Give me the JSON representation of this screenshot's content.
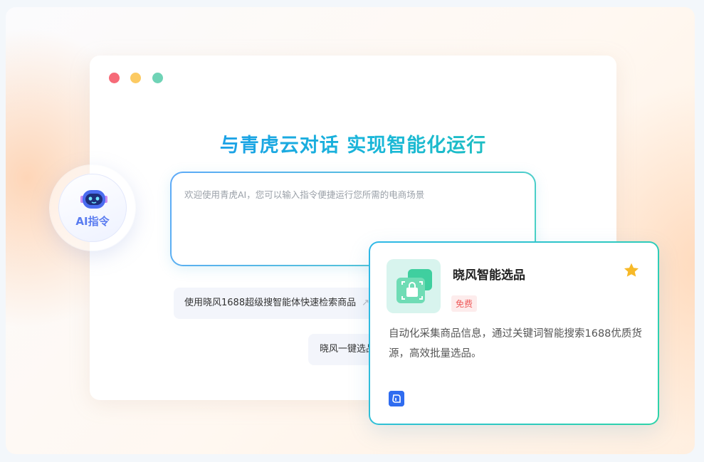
{
  "headline": "与青虎云对话 实现智能化运行",
  "prompt": {
    "placeholder": "欢迎使用青虎AI，您可以输入指令便捷运行您所需的电商场景"
  },
  "suggestions": [
    {
      "label": "使用晓风1688超级搜智能体快速检索商品",
      "arrow": "↗"
    },
    {
      "label": "晓风一键选品"
    }
  ],
  "ai_button": {
    "label": "AI指令",
    "icon": "robot-icon"
  },
  "card": {
    "title": "晓风智能选品",
    "badge": "免费",
    "description": "自动化采集商品信息，通过关键词智能搜索1688优质货源，高效批量选品。",
    "star_icon": "star-icon",
    "footer_icon": "app-logo-icon",
    "colors": {
      "accent_border": "#2fb8e8",
      "star": "#f7b928",
      "badge_text": "#ef5a5a"
    }
  },
  "window_controls": [
    "close-dot",
    "minimize-dot",
    "maximize-dot"
  ]
}
